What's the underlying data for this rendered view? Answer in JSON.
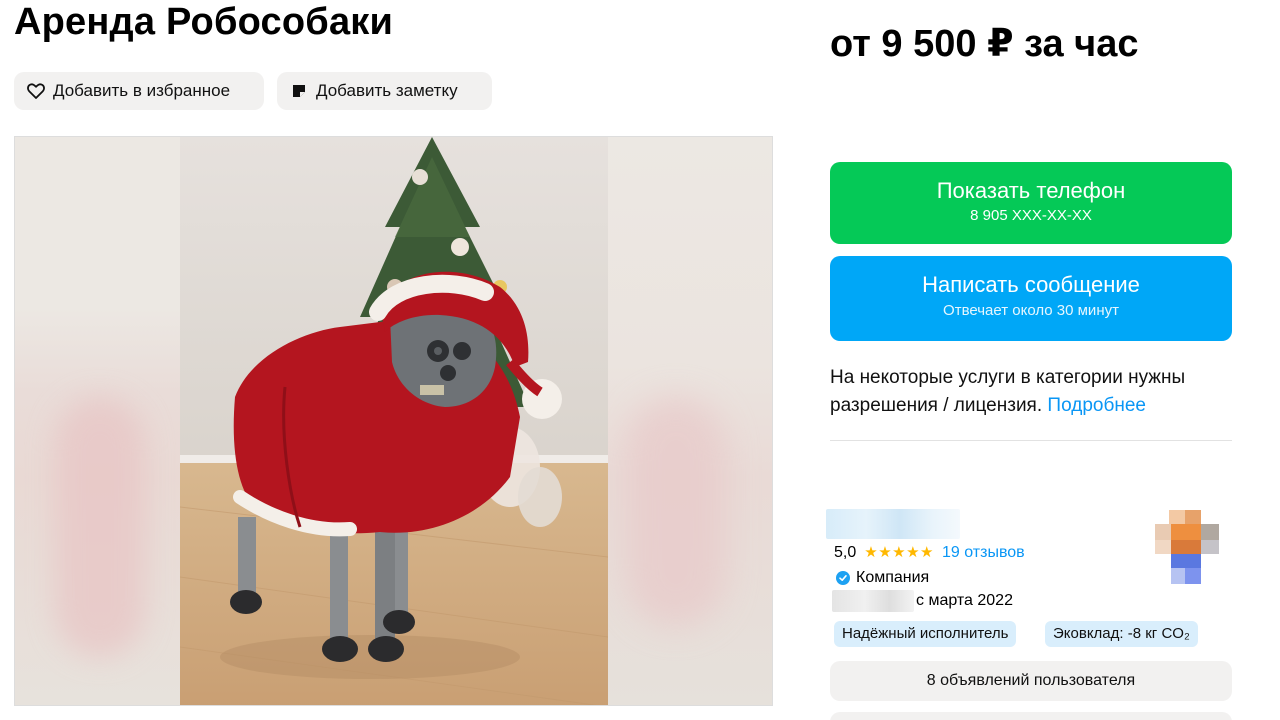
{
  "listing": {
    "title": "Аренда Робособаки",
    "price": "от 9 500 ₽ за час"
  },
  "actions": {
    "favorite_label": "Добавить в избранное",
    "note_label": "Добавить заметку"
  },
  "contact": {
    "phone_label": "Показать телефон",
    "phone_masked": "8 905 XXX-XX-XX",
    "message_label": "Написать сообщение",
    "message_sub": "Отвечает около 30 минут"
  },
  "notice": {
    "text": "На некоторые услуги в категории нужны разрешения / лицензия.",
    "link": "Подробнее"
  },
  "seller": {
    "rating": "5,0",
    "stars": "★★★★★",
    "reviews": "19 отзывов",
    "type": "Компания",
    "since": "с марта 2022",
    "badges": [
      "Надёжный исполнитель",
      "Эковклад: -8 кг CO₂"
    ],
    "listings_button": "8 объявлений пользователя"
  },
  "icons": {
    "favorite": "heart-icon",
    "note": "note-icon",
    "verified": "verified-check-icon"
  },
  "colors": {
    "phone_button": "#05c957",
    "message_button": "#00a7f7",
    "link": "#0996f5",
    "stars": "#ffb800",
    "badge": "#d9eefc"
  }
}
